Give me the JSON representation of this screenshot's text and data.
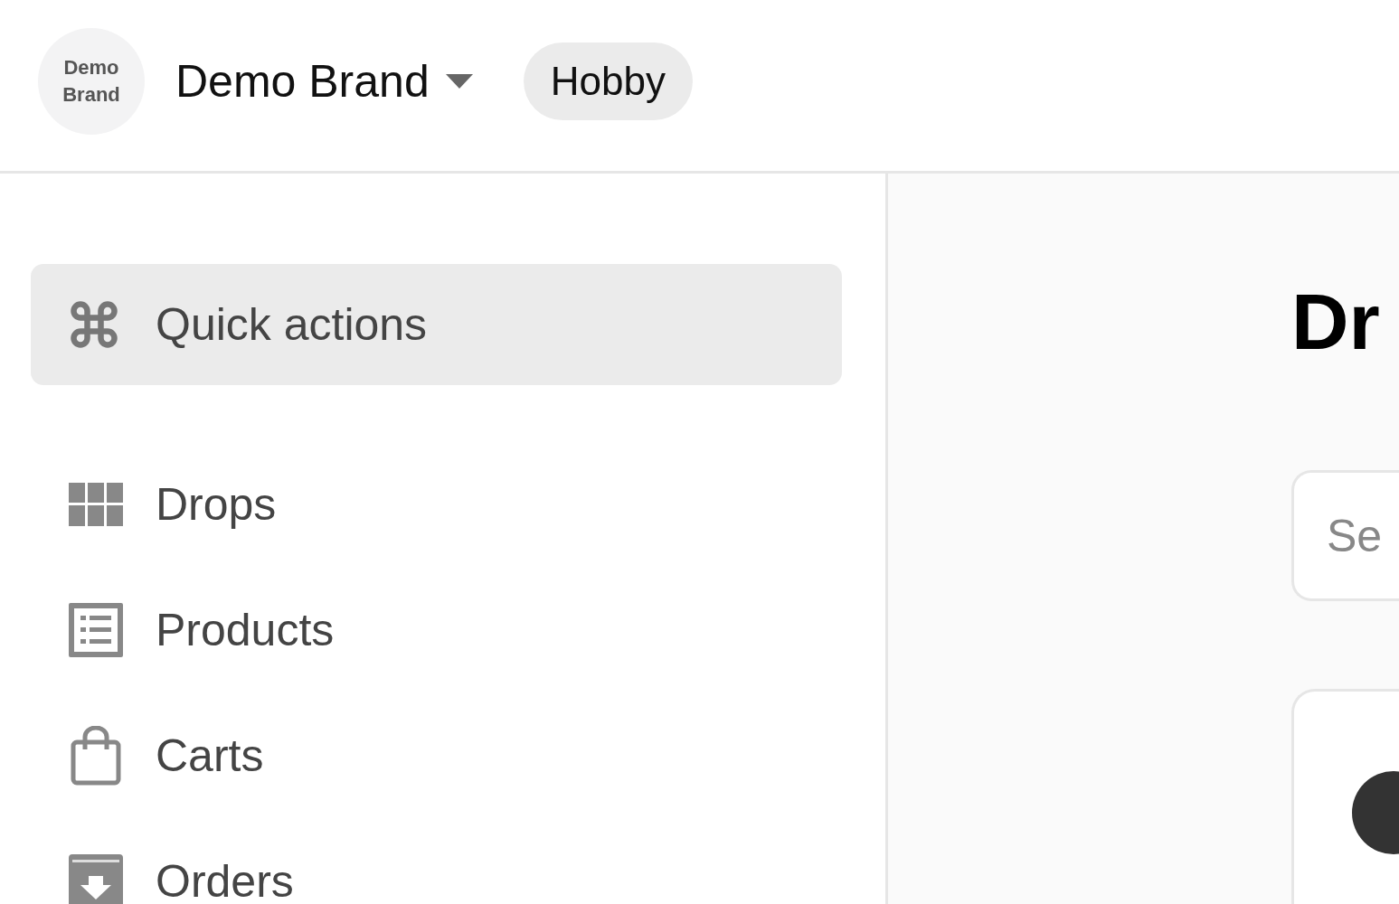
{
  "header": {
    "logo_text": "Demo Brand",
    "brand": "Demo Brand",
    "plan_badge": "Hobby"
  },
  "sidebar": {
    "quick_actions": "Quick actions",
    "items": [
      {
        "label": "Drops"
      },
      {
        "label": "Products"
      },
      {
        "label": "Carts"
      },
      {
        "label": "Orders"
      }
    ]
  },
  "main": {
    "title": "Dr",
    "search": {
      "placeholder": "Se"
    }
  }
}
